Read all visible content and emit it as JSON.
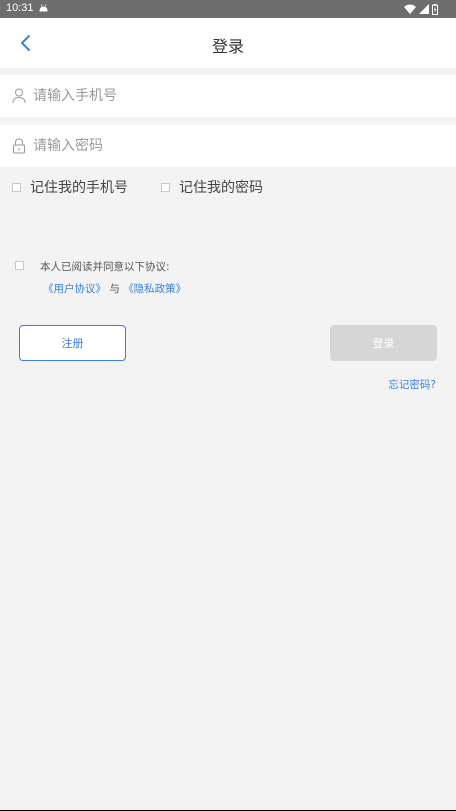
{
  "status_bar": {
    "time": "10:31"
  },
  "header": {
    "title": "登录"
  },
  "form": {
    "phone_placeholder": "请输入手机号",
    "password_placeholder": "请输入密码",
    "remember_phone_label": "记住我的手机号",
    "remember_password_label": "记住我的密码"
  },
  "agreement": {
    "text": "本人已阅读并同意以下协议:",
    "user_agreement": "《用户协议》",
    "conjunction": "与",
    "privacy_policy": "《隐私政策》"
  },
  "actions": {
    "register_label": "注册",
    "login_label": "登录",
    "forgot_password": "忘记密码?"
  },
  "colors": {
    "accent": "#3a7fd9",
    "disabled_button": "#d6d6d6",
    "background": "#f3f3f3"
  }
}
